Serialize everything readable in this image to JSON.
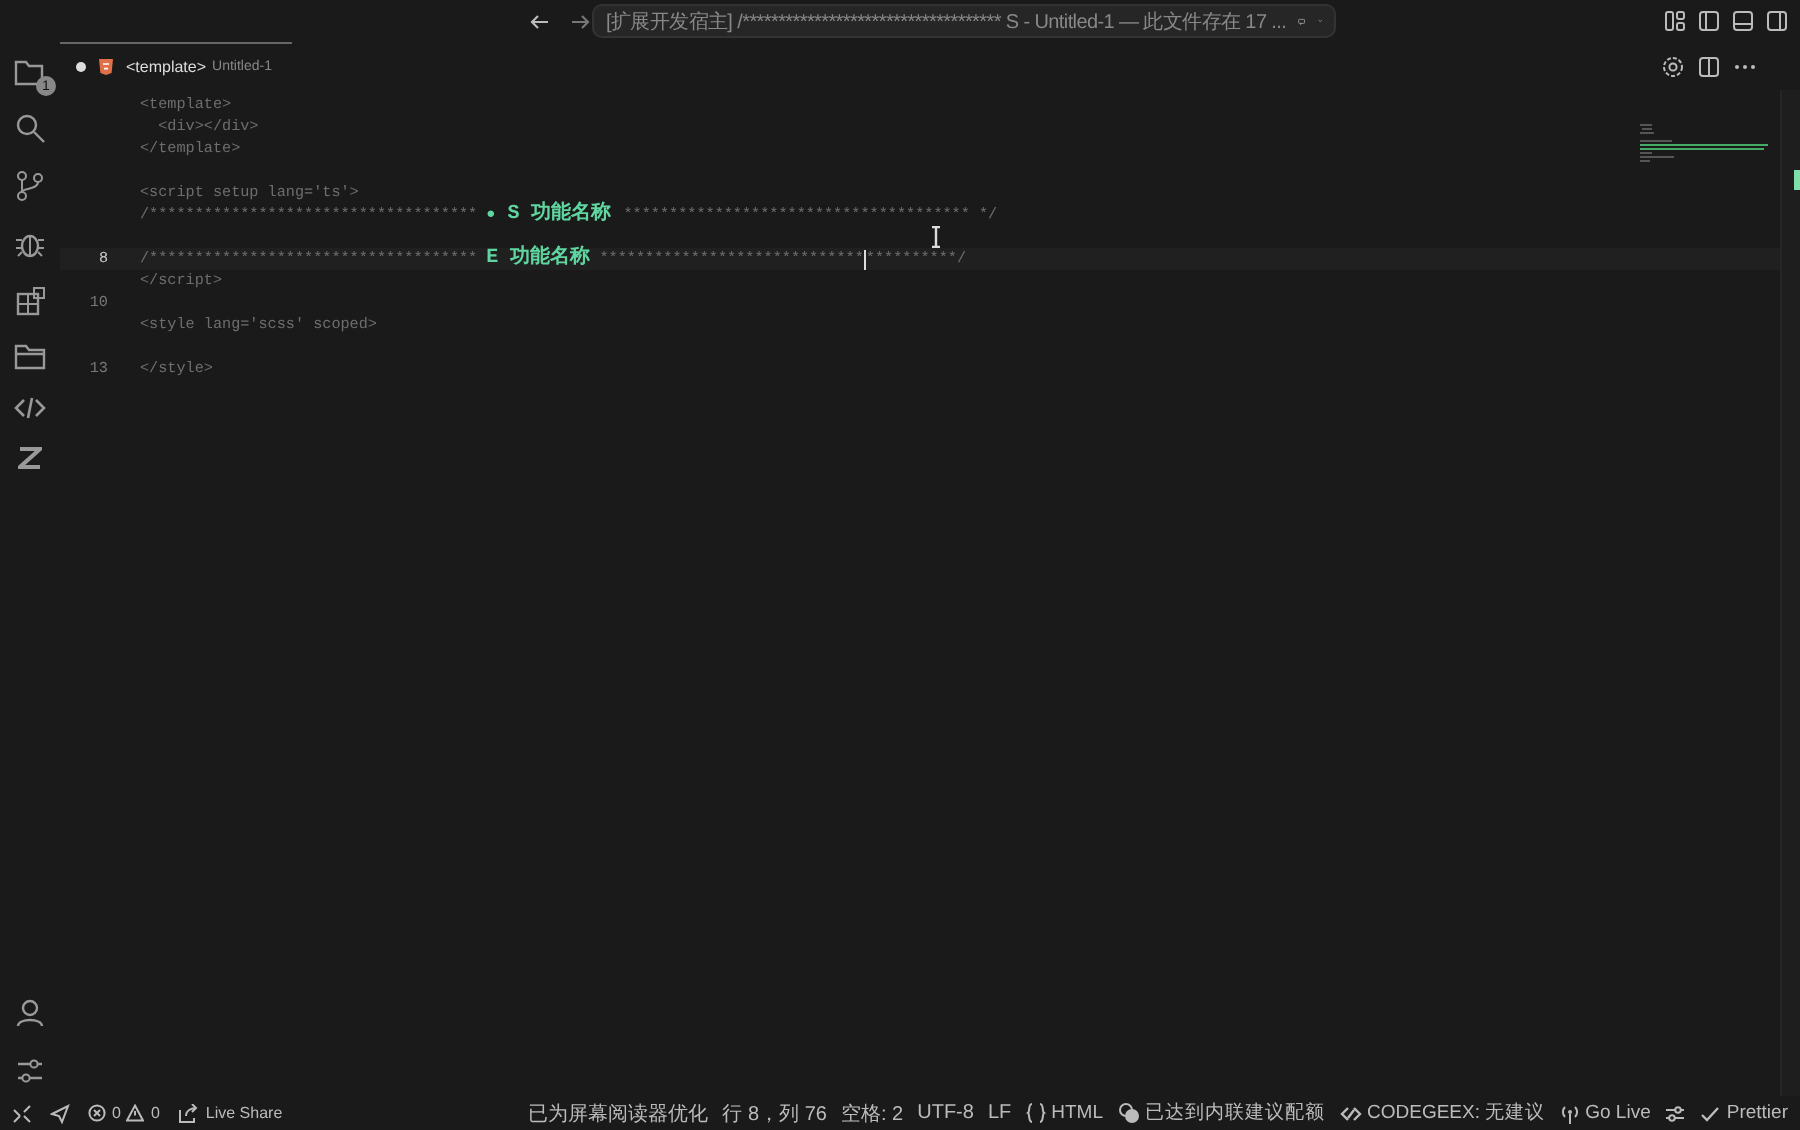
{
  "title_bar": {
    "command_center": "[扩展开发宿主] /************************************ S - Untitled-1 — 此文件存在 17 ..."
  },
  "activity_bar": {
    "explorer_badge": "1"
  },
  "tab": {
    "label": "<template>",
    "description": "Untitled-1",
    "modified": true,
    "selected": true
  },
  "editor": {
    "lines": [
      {
        "segments": [
          {
            "text": "<template>",
            "kind": "plain"
          }
        ]
      },
      {
        "segments": [
          {
            "text": "  <div></div>",
            "kind": "plain"
          }
        ]
      },
      {
        "segments": [
          {
            "text": "</template>",
            "kind": "plain"
          }
        ]
      },
      {
        "gap_before": true,
        "segments": [
          {
            "text": "<script setup lang='ts'>",
            "kind": "plain"
          }
        ]
      },
      {
        "segments": [
          {
            "text": "/************************************ ",
            "kind": "plain"
          },
          {
            "text": "●",
            "kind": "dot"
          },
          {
            "text": " S 功能名称 ",
            "kind": "accent"
          },
          {
            "text": "************************************** */",
            "kind": "plain"
          }
        ]
      },
      {
        "gap_before": true,
        "number": "8",
        "current": true,
        "segments": [
          {
            "text": "/************************************ ",
            "kind": "plain"
          },
          {
            "text": "E 功能名称",
            "kind": "accent"
          },
          {
            "text": " *****************************",
            "kind": "plain",
            "caret_after": true
          },
          {
            "text": "**********/",
            "kind": "plain"
          }
        ]
      },
      {
        "segments": [
          {
            "text": "</script>",
            "kind": "plain"
          }
        ]
      },
      {
        "number": "10"
      },
      {
        "segments": [
          {
            "text": "<style lang='scss' scoped>",
            "kind": "plain"
          }
        ]
      },
      {
        "gap_before": true,
        "number": "13",
        "segments": [
          {
            "text": "</style>",
            "kind": "plain"
          }
        ]
      }
    ]
  },
  "status_bar": {
    "left": [
      {
        "kind": "problems",
        "errors": "0",
        "warnings": "0"
      },
      {
        "kind": "live_share",
        "text": "Live Share"
      }
    ],
    "right": [
      {
        "kind": "text",
        "text": "已为屏幕阅读器优化"
      },
      {
        "kind": "text",
        "text": "行 8，列 76"
      },
      {
        "kind": "text",
        "text": "空格: 2"
      },
      {
        "kind": "text",
        "text": "UTF-8"
      },
      {
        "kind": "text",
        "text": "LF"
      },
      {
        "kind": "language",
        "text": "HTML"
      },
      {
        "kind": "quota",
        "text": "已达到内联建议配额"
      },
      {
        "kind": "codegeex",
        "text": "CODEGEEX: 无建议"
      },
      {
        "kind": "go_live",
        "text": "Go Live"
      },
      {
        "kind": "settings"
      },
      {
        "kind": "prettier",
        "text": "Prettier"
      }
    ]
  }
}
